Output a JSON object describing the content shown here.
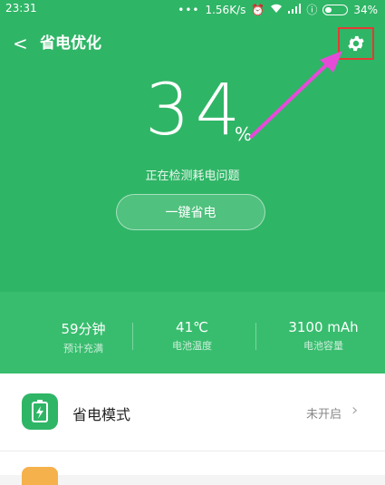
{
  "status_bar": {
    "time": "23:31",
    "net_speed": "1.56K/s",
    "battery_pct": "34%"
  },
  "header": {
    "title": "省电优化",
    "back": "<"
  },
  "battery": {
    "level": "34",
    "unit": "%",
    "checking_text": "正在检测耗电问题",
    "button": "一键省电"
  },
  "stats": [
    {
      "value": "59分钟",
      "label": "预计充满"
    },
    {
      "value": "41℃",
      "label": "电池温度"
    },
    {
      "value": "3100 mAh",
      "label": "电池容量"
    }
  ],
  "list": [
    {
      "label": "省电模式",
      "status": "未开启"
    }
  ],
  "colors": {
    "primary": "#2fb566",
    "highlight": "#e53935",
    "arrow": "#e64bd8",
    "secondary_icon": "#f5b14c"
  }
}
